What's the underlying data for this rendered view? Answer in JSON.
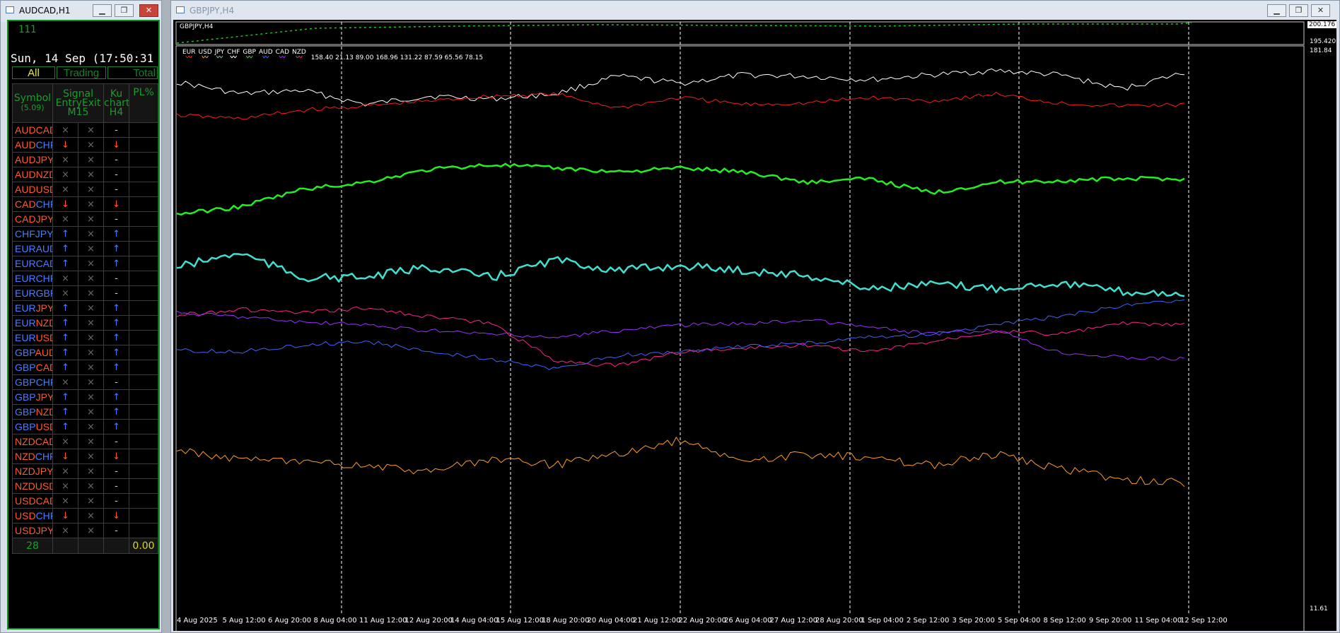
{
  "left_window": {
    "title": "AUDCAD,H1",
    "indicator_value": "111",
    "datetime": "Sun, 14 Sep (17:50:31",
    "tabs": [
      "All",
      "Trading",
      "Total"
    ],
    "headers": {
      "symbol": "Symbol",
      "symbol_sub": "(5.09)",
      "signal": "Signal",
      "entry": "Entry",
      "exit": "Exit",
      "m15": "M15",
      "ku": "Ku",
      "chart": "chart",
      "h4": "H4",
      "pl": "PL%"
    },
    "rows": [
      {
        "base": "AUD",
        "quote": "CAD",
        "bc": "#ff5a2a",
        "qc": "#ff5a2a",
        "entry": "×",
        "ec": "#6a6a6a",
        "exit": "×",
        "h4": "-",
        "hc": "#cccccc"
      },
      {
        "base": "AUD",
        "quote": "CHF",
        "bc": "#ff5a2a",
        "qc": "#4a7dff",
        "entry": "↓",
        "ec": "#ff5a1a",
        "exit": "×",
        "h4": "↓",
        "hc": "#ff5a1a"
      },
      {
        "base": "AUD",
        "quote": "JPY",
        "bc": "#ff5a2a",
        "qc": "#ff5a2a",
        "entry": "×",
        "ec": "#6a6a6a",
        "exit": "×",
        "h4": "-",
        "hc": "#cccccc"
      },
      {
        "base": "AUD",
        "quote": "NZD",
        "bc": "#ff5a2a",
        "qc": "#ff5a2a",
        "entry": "×",
        "ec": "#6a6a6a",
        "exit": "×",
        "h4": "-",
        "hc": "#cccccc"
      },
      {
        "base": "AUD",
        "quote": "USD",
        "bc": "#ff5a2a",
        "qc": "#ff5a2a",
        "entry": "×",
        "ec": "#6a6a6a",
        "exit": "×",
        "h4": "-",
        "hc": "#cccccc"
      },
      {
        "base": "CAD",
        "quote": "CHF",
        "bc": "#ff5a2a",
        "qc": "#4a7dff",
        "entry": "↓",
        "ec": "#ff5a1a",
        "exit": "×",
        "h4": "↓",
        "hc": "#ff5a1a"
      },
      {
        "base": "CAD",
        "quote": "JPY",
        "bc": "#ff5a2a",
        "qc": "#ff5a2a",
        "entry": "×",
        "ec": "#6a6a6a",
        "exit": "×",
        "h4": "-",
        "hc": "#cccccc"
      },
      {
        "base": "CHF",
        "quote": "JPY",
        "bc": "#4a7dff",
        "qc": "#4a7dff",
        "entry": "↑",
        "ec": "#4a7dff",
        "exit": "×",
        "h4": "↑",
        "hc": "#4a7dff"
      },
      {
        "base": "EUR",
        "quote": "AUD",
        "bc": "#4a7dff",
        "qc": "#4a7dff",
        "entry": "↑",
        "ec": "#4a7dff",
        "exit": "×",
        "h4": "↑",
        "hc": "#4a7dff"
      },
      {
        "base": "EUR",
        "quote": "CAD",
        "bc": "#4a7dff",
        "qc": "#4a7dff",
        "entry": "↑",
        "ec": "#4a7dff",
        "exit": "×",
        "h4": "↑",
        "hc": "#4a7dff"
      },
      {
        "base": "EUR",
        "quote": "CHF",
        "bc": "#4a7dff",
        "qc": "#4a7dff",
        "entry": "×",
        "ec": "#6a6a6a",
        "exit": "×",
        "h4": "-",
        "hc": "#cccccc"
      },
      {
        "base": "EUR",
        "quote": "GBP",
        "bc": "#4a7dff",
        "qc": "#4a7dff",
        "entry": "×",
        "ec": "#6a6a6a",
        "exit": "×",
        "h4": "-",
        "hc": "#cccccc"
      },
      {
        "base": "EUR",
        "quote": "JPY",
        "bc": "#4a7dff",
        "qc": "#ff5a2a",
        "entry": "↑",
        "ec": "#4a7dff",
        "exit": "×",
        "h4": "↑",
        "hc": "#4a7dff"
      },
      {
        "base": "EUR",
        "quote": "NZD",
        "bc": "#4a7dff",
        "qc": "#ff5a2a",
        "entry": "↑",
        "ec": "#4a7dff",
        "exit": "×",
        "h4": "↑",
        "hc": "#4a7dff"
      },
      {
        "base": "EUR",
        "quote": "USD",
        "bc": "#4a7dff",
        "qc": "#ff5a2a",
        "entry": "↑",
        "ec": "#4a7dff",
        "exit": "×",
        "h4": "↑",
        "hc": "#4a7dff"
      },
      {
        "base": "GBP",
        "quote": "AUD",
        "bc": "#4a7dff",
        "qc": "#ff5a2a",
        "entry": "↑",
        "ec": "#4a7dff",
        "exit": "×",
        "h4": "↑",
        "hc": "#4a7dff"
      },
      {
        "base": "GBP",
        "quote": "CAD",
        "bc": "#4a7dff",
        "qc": "#ff5a2a",
        "entry": "↑",
        "ec": "#4a7dff",
        "exit": "×",
        "h4": "↑",
        "hc": "#4a7dff"
      },
      {
        "base": "GBP",
        "quote": "CHF",
        "bc": "#4a7dff",
        "qc": "#4a7dff",
        "entry": "×",
        "ec": "#6a6a6a",
        "exit": "×",
        "h4": "-",
        "hc": "#cccccc"
      },
      {
        "base": "GBP",
        "quote": "JPY",
        "bc": "#4a7dff",
        "qc": "#ff5a2a",
        "entry": "↑",
        "ec": "#4a7dff",
        "exit": "×",
        "h4": "↑",
        "hc": "#4a7dff"
      },
      {
        "base": "GBP",
        "quote": "NZD",
        "bc": "#4a7dff",
        "qc": "#ff5a2a",
        "entry": "↑",
        "ec": "#4a7dff",
        "exit": "×",
        "h4": "↑",
        "hc": "#4a7dff"
      },
      {
        "base": "GBP",
        "quote": "USD",
        "bc": "#4a7dff",
        "qc": "#ff5a2a",
        "entry": "↑",
        "ec": "#4a7dff",
        "exit": "×",
        "h4": "↑",
        "hc": "#4a7dff"
      },
      {
        "base": "NZD",
        "quote": "CAD",
        "bc": "#ff5a2a",
        "qc": "#ff5a2a",
        "entry": "×",
        "ec": "#6a6a6a",
        "exit": "×",
        "h4": "-",
        "hc": "#cccccc"
      },
      {
        "base": "NZD",
        "quote": "CHF",
        "bc": "#ff5a2a",
        "qc": "#4a7dff",
        "entry": "↓",
        "ec": "#ff5a1a",
        "exit": "×",
        "h4": "↓",
        "hc": "#ff5a1a"
      },
      {
        "base": "NZD",
        "quote": "JPY",
        "bc": "#ff5a2a",
        "qc": "#ff5a2a",
        "entry": "×",
        "ec": "#6a6a6a",
        "exit": "×",
        "h4": "-",
        "hc": "#cccccc"
      },
      {
        "base": "NZD",
        "quote": "USD",
        "bc": "#ff5a2a",
        "qc": "#ff5a2a",
        "entry": "×",
        "ec": "#6a6a6a",
        "exit": "×",
        "h4": "-",
        "hc": "#cccccc"
      },
      {
        "base": "USD",
        "quote": "CAD",
        "bc": "#ff5a2a",
        "qc": "#ff5a2a",
        "entry": "×",
        "ec": "#6a6a6a",
        "exit": "×",
        "h4": "-",
        "hc": "#cccccc"
      },
      {
        "base": "USD",
        "quote": "CHF",
        "bc": "#ff5a2a",
        "qc": "#4a7dff",
        "entry": "↓",
        "ec": "#ff5a1a",
        "exit": "×",
        "h4": "↓",
        "hc": "#ff5a1a"
      },
      {
        "base": "USD",
        "quote": "JPY",
        "bc": "#ff5a2a",
        "qc": "#ff5a2a",
        "entry": "×",
        "ec": "#6a6a6a",
        "exit": "×",
        "h4": "-",
        "hc": "#cccccc"
      }
    ],
    "footer": {
      "count": "28",
      "pl": "0.00"
    },
    "colors": {
      "border": "#0b8f23",
      "green_text": "#1b9c2c",
      "yellow_text": "#d6d62a",
      "strong": "#ff5a2a",
      "weak": "#4a7dff"
    }
  },
  "right_window": {
    "title": "GBPJPY,H4",
    "chart_label": "GBPJPY,H4",
    "subwindow_prices": [
      "200.176",
      "195.420"
    ],
    "price_top": "181.84",
    "price_bottom": "11.61",
    "legend_currencies": [
      {
        "name": "EUR",
        "color": "#ff1a1a"
      },
      {
        "name": "USD",
        "color": "#ffa020"
      },
      {
        "name": "JPY",
        "color": "#40e0d0"
      },
      {
        "name": "CHF",
        "color": "#ffffff"
      },
      {
        "name": "GBP",
        "color": "#22ee22"
      },
      {
        "name": "AUD",
        "color": "#4060ff"
      },
      {
        "name": "CAD",
        "color": "#9b30ff"
      },
      {
        "name": "NZD",
        "color": "#ff2090"
      }
    ],
    "legend_values": "158.40 21.13 89.00 168.96 131.22 87.59 65.56 78.15",
    "x_labels": [
      "4 Aug 2025",
      "5 Aug 12:00",
      "6 Aug 20:00",
      "8 Aug 04:00",
      "11 Aug 12:00",
      "12 Aug 20:00",
      "14 Aug 04:00",
      "15 Aug 12:00",
      "18 Aug 20:00",
      "20 Aug 04:00",
      "21 Aug 12:00",
      "22 Aug 20:00",
      "26 Aug 04:00",
      "27 Aug 12:00",
      "28 Aug 20:00",
      "1 Sep 04:00",
      "2 Sep 12:00",
      "3 Sep 20:00",
      "5 Sep 04:00",
      "8 Sep 12:00",
      "9 Sep 20:00",
      "11 Sep 04:00",
      "12 Sep 12:00"
    ]
  }
}
